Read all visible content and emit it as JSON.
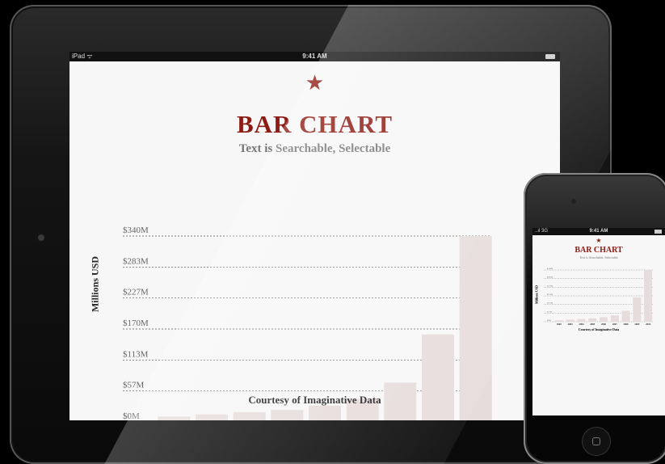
{
  "ipad": {
    "carrier": "iPad ᯤ",
    "time": "9:41 AM"
  },
  "iphone": {
    "carrier": "..ıl 3G",
    "time": "9:41 AM"
  },
  "chart_data": {
    "type": "bar",
    "star": "★",
    "title": "BAR CHART",
    "subtitle": "Text is Searchable, Selectable",
    "ylabel": "Millions USD",
    "xlabel": "",
    "footer": "Courtesy of Imaginative Data",
    "categories": [
      "2002",
      "2003",
      "2004",
      "2005",
      "2006",
      "2007",
      "2008",
      "2009",
      "2010"
    ],
    "values": [
      10,
      14,
      18,
      22,
      30,
      42,
      72,
      160,
      340
    ],
    "yticks": [
      "$0M",
      "$57M",
      "$113M",
      "$170M",
      "$227M",
      "$283M",
      "$340M"
    ],
    "ytick_values": [
      0,
      57,
      113,
      170,
      227,
      283,
      340
    ],
    "ylim": [
      0,
      340
    ],
    "grid": true,
    "bar_color": "#e7dcdc",
    "accent_color": "#8d1a13"
  }
}
